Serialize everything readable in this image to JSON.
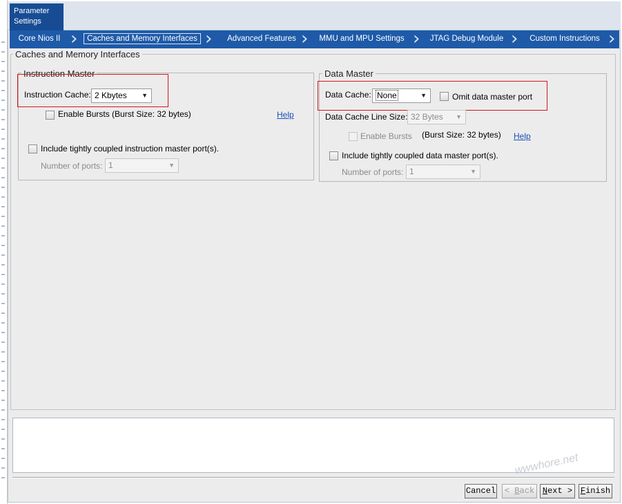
{
  "window": {
    "left_tab": "Parameter\nSettings"
  },
  "wizard_steps": [
    {
      "label": "Core Nios II"
    },
    {
      "label": "Caches and Memory Interfaces",
      "active": true
    },
    {
      "label": "Advanced Features"
    },
    {
      "label": "MMU and MPU Settings"
    },
    {
      "label": "JTAG Debug Module"
    },
    {
      "label": "Custom Instructions"
    }
  ],
  "main_group_title": "Caches and Memory Interfaces",
  "instruction_master": {
    "title": "Instruction Master",
    "cache_label": "Instruction Cache:",
    "cache_value": "2 Kbytes",
    "enable_bursts_label": "Enable Bursts (Burst Size: 32 bytes)",
    "enable_bursts_checked": false,
    "help_link": "Help",
    "tightly_coupled_label": "Include tightly coupled instruction master port(s).",
    "tightly_coupled_checked": false,
    "num_ports_label": "Number of ports:",
    "num_ports_value": "1"
  },
  "data_master": {
    "title": "Data Master",
    "cache_label": "Data Cache:",
    "cache_value": "None",
    "omit_label": "Omit data master port",
    "omit_checked": false,
    "line_size_label": "Data Cache Line Size:",
    "line_size_value": "32 Bytes",
    "enable_bursts_label": "Enable Bursts",
    "burst_size_text": "(Burst Size: 32 bytes)",
    "help_link": "Help",
    "tightly_coupled_label": "Include tightly coupled data master port(s).",
    "tightly_coupled_checked": false,
    "num_ports_label": "Number of ports:",
    "num_ports_value": "1"
  },
  "buttons": {
    "cancel": "Cancel",
    "back_prefix": "< ",
    "back_key": "B",
    "back_rest": "ack",
    "next_key": "N",
    "next_rest": "ext >",
    "finish_key": "F",
    "finish_rest": "inish"
  },
  "watermark": "wwwhore.net",
  "colors": {
    "step_bar": "#1e5aa8",
    "active_tab": "#174c94",
    "highlight_box": "#d5141b",
    "link": "#1a4fb6"
  },
  "icons": {
    "dropdown": "triangle-down",
    "step_separator": "chevron-right"
  }
}
